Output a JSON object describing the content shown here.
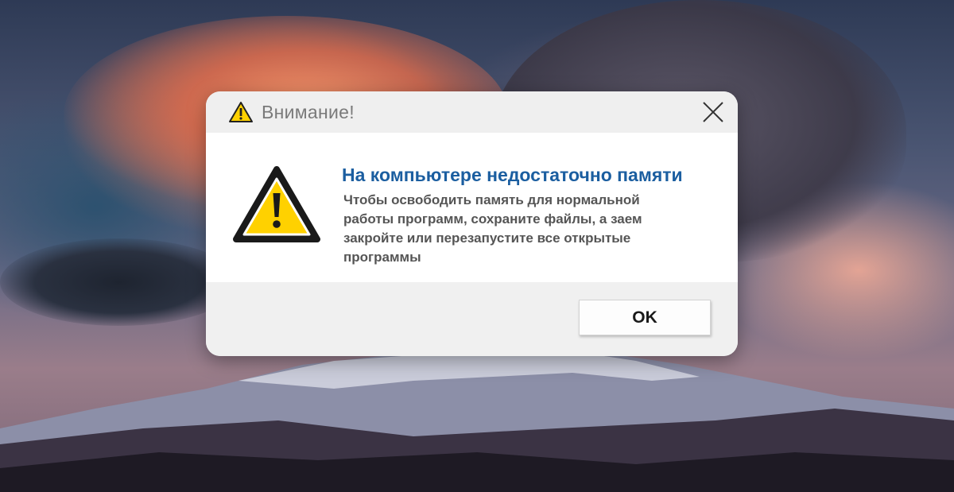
{
  "dialog": {
    "title": "Внимание!",
    "title_icon": "warning-icon",
    "close_icon": "close-icon",
    "heading": "На компьютере недостаточно памяти",
    "message": "Чтобы освободить память для нормальной работы программ, сохраните файлы, а заем закройте или перезапустите все открытые программы",
    "ok_label": "OK"
  },
  "colors": {
    "heading": "#1b5ea0",
    "warning_fill": "#ffd100",
    "dialog_bg": "#f0f0f0",
    "content_bg": "#ffffff"
  }
}
